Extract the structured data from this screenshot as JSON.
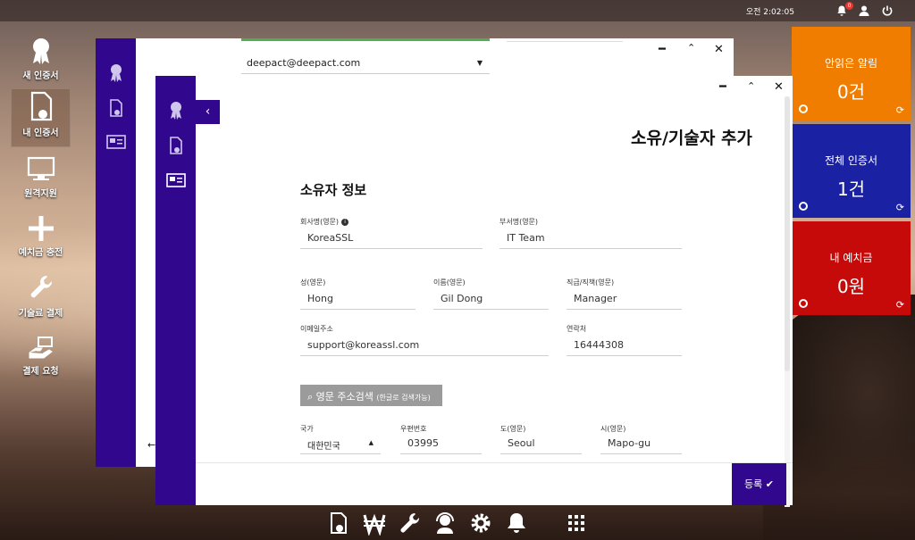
{
  "topbar": {
    "clock": "오전 2:02:05",
    "notification_count": "0"
  },
  "desktop": {
    "icons": [
      {
        "label": "새 인증서"
      },
      {
        "label": "내 인증서"
      },
      {
        "label": "원격지원"
      },
      {
        "label": "예치금 충전"
      },
      {
        "label": "기술료 결제"
      },
      {
        "label": "결제 요청"
      }
    ]
  },
  "tiles": [
    {
      "title": "안읽은 알림",
      "value": "0건",
      "color": "#f07d00"
    },
    {
      "title": "전체 인증서",
      "value": "1건",
      "color": "#1a22a3"
    },
    {
      "title": "내 예치금",
      "value": "0원",
      "color": "#c60a0a"
    }
  ],
  "back_window": {
    "email_select": "deepact@deepact.com"
  },
  "form": {
    "title": "소유/기술자 추가",
    "section": "소유자 정보",
    "company_label": "회사명(영문)",
    "company_value": "KoreaSSL",
    "dept_label": "부서명(영문)",
    "dept_value": "IT Team",
    "last_name_label": "성(영문)",
    "last_name_value": "Hong",
    "first_name_label": "이름(영문)",
    "first_name_value": "Gil Dong",
    "position_label": "직급/직책(영문)",
    "position_value": "Manager",
    "email_label": "이메일주소",
    "email_value": "support@koreassl.com",
    "phone_label": "연락처",
    "phone_value": "16444308",
    "address_button": "영문 주소검색",
    "address_button_note": "(한글로 검색가능)",
    "country_label": "국가",
    "country_value": "대한민국",
    "zip_label": "우편번호",
    "zip_value": "03995",
    "province_label": "도(영문)",
    "province_value": "Seoul",
    "city_label": "시(영문)",
    "city_value": "Mapo-gu",
    "submit_label": "등록"
  }
}
